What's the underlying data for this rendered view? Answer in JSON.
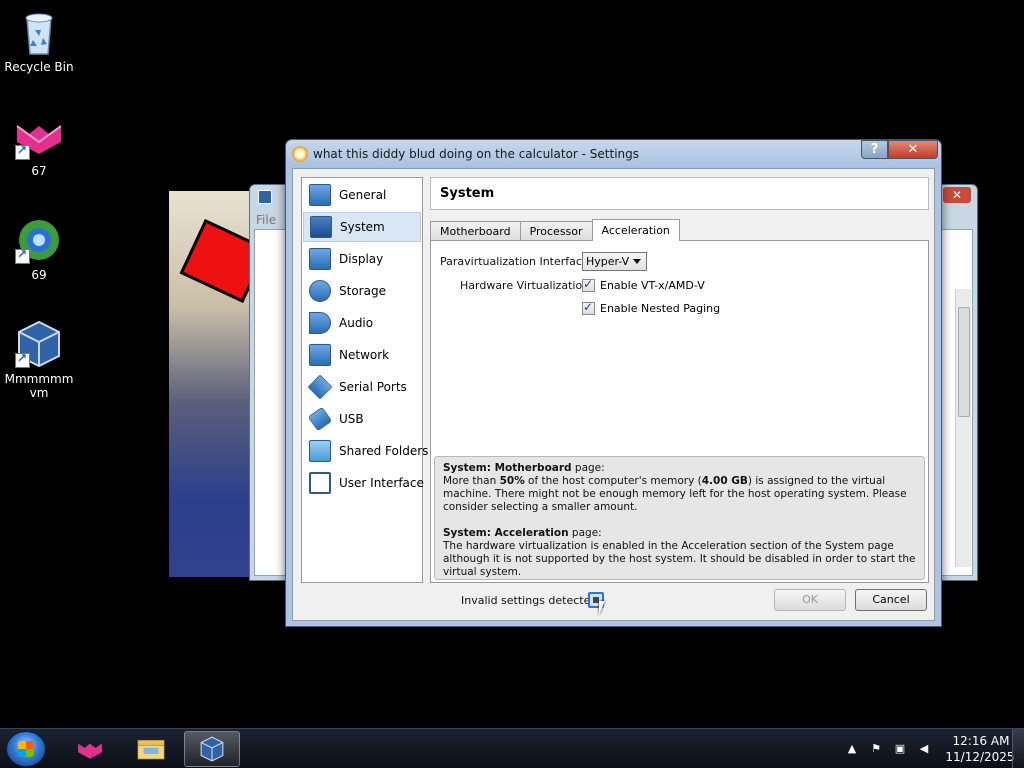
{
  "desktop": {
    "icons": [
      {
        "label": "Recycle Bin",
        "icon": "recycle-bin-icon"
      },
      {
        "label": "67",
        "icon": "pink-cat-shortcut-icon"
      },
      {
        "label": "69",
        "icon": "browser-globe-shortcut-icon"
      },
      {
        "label": "Mmmmmm vm",
        "icon": "virtualbox-shortcut-icon"
      }
    ]
  },
  "background_window": {
    "close_glyph": "✕",
    "menu_hint": "File"
  },
  "settings_dialog": {
    "title": "what this diddy blud doing on the calculator - Settings",
    "help_label": "?",
    "close_label": "✕",
    "nav": [
      {
        "label": "General",
        "icon": "general-icon"
      },
      {
        "label": "System",
        "icon": "system-icon",
        "selected": true
      },
      {
        "label": "Display",
        "icon": "display-icon"
      },
      {
        "label": "Storage",
        "icon": "storage-icon"
      },
      {
        "label": "Audio",
        "icon": "audio-icon"
      },
      {
        "label": "Network",
        "icon": "network-icon"
      },
      {
        "label": "Serial Ports",
        "icon": "serial-ports-icon"
      },
      {
        "label": "USB",
        "icon": "usb-icon"
      },
      {
        "label": "Shared Folders",
        "icon": "shared-folders-icon"
      },
      {
        "label": "User Interface",
        "icon": "user-interface-icon"
      }
    ],
    "section_title": "System",
    "tabs": [
      {
        "label": "Motherboard"
      },
      {
        "label": "Processor"
      },
      {
        "label": "Acceleration",
        "active": true
      }
    ],
    "acceleration": {
      "paravirt_label": "Paravirtualization Interface:",
      "paravirt_value": "Hyper-V",
      "hw_virt_label": "Hardware Virtualization:",
      "enable_vtx_label": "Enable VT-x/AMD-V",
      "enable_vtx_checked": true,
      "nested_paging_label": "Enable Nested Paging",
      "nested_paging_checked": true
    },
    "warnings": {
      "motherboard_title": "System: Motherboard",
      "motherboard_suffix": " page:",
      "motherboard_line1_pre": "More than ",
      "motherboard_pct": "50%",
      "motherboard_line1_mid": " of the host computer's memory (",
      "motherboard_mem": "4.00 GB",
      "motherboard_line1_post": ") is assigned to the virtual machine.",
      "motherboard_rest": "There might not be enough memory left for the host operating system. Please consider selecting a smaller amount.",
      "acceleration_title": "System: Acceleration",
      "acceleration_suffix": " page:",
      "acceleration_text": "The hardware virtualization is enabled in the Acceleration section of the System page although it is not supported by the host system. It should be disabled in order to start the virtual system."
    },
    "status_text": "Invalid settings detected",
    "ok_label": "OK",
    "cancel_label": "Cancel"
  },
  "taskbar": {
    "time": "12:16 AM",
    "date": "11/12/2025",
    "apps": [
      "pink-cat-app-icon",
      "file-explorer-icon",
      "virtualbox-app-icon"
    ],
    "tray_icons": [
      "show-hidden-icons-icon",
      "action-center-flag-icon",
      "network-icon",
      "volume-muted-icon"
    ]
  }
}
